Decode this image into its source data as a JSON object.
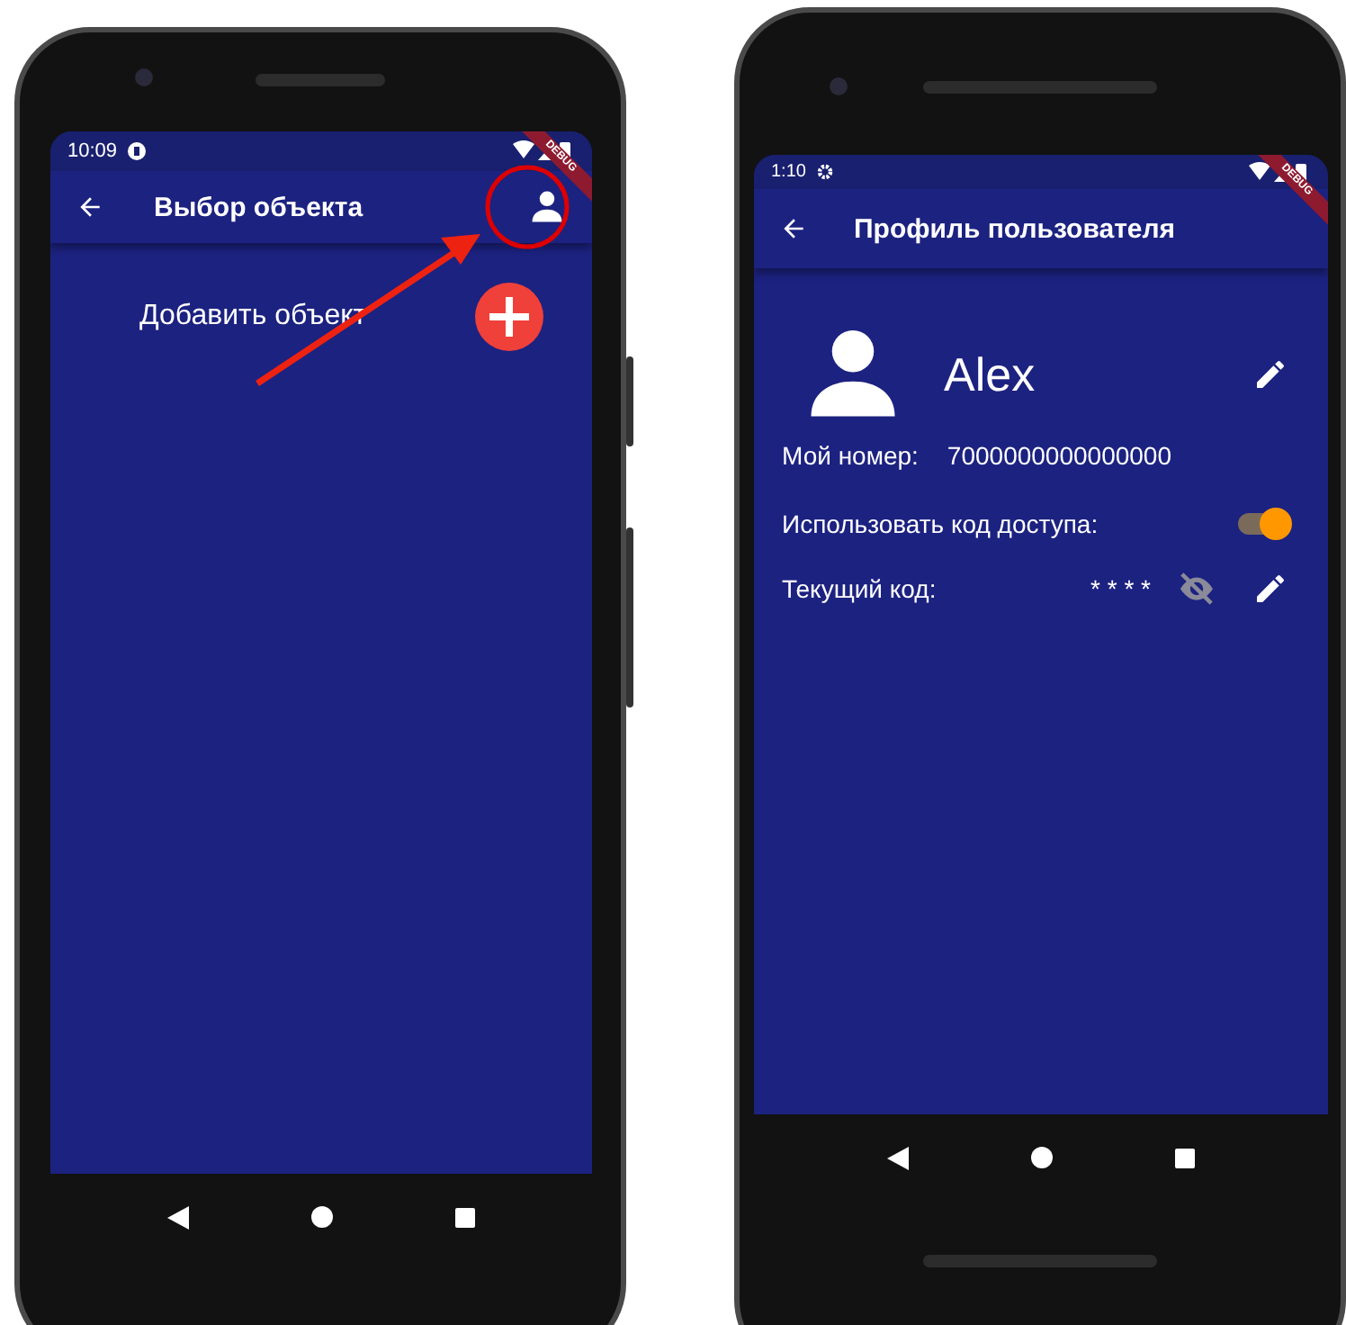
{
  "phones": [
    {
      "kind": "list",
      "status_time": "10:09",
      "debug": "DEBUG",
      "title": "Выбор объекта",
      "add_label": "Добавить объект",
      "annotated": true
    },
    {
      "kind": "profile",
      "status_time": "1:10",
      "debug": "DEBUG",
      "title": "Профиль пользователя",
      "user_name": "Alex",
      "number_label": "Мой номер:",
      "number": "7000000000000000",
      "access_label": "Использовать код доступа:",
      "access_on": true,
      "code_label": "Текущий код:",
      "code": "* * * *",
      "code_visible": false
    }
  ]
}
